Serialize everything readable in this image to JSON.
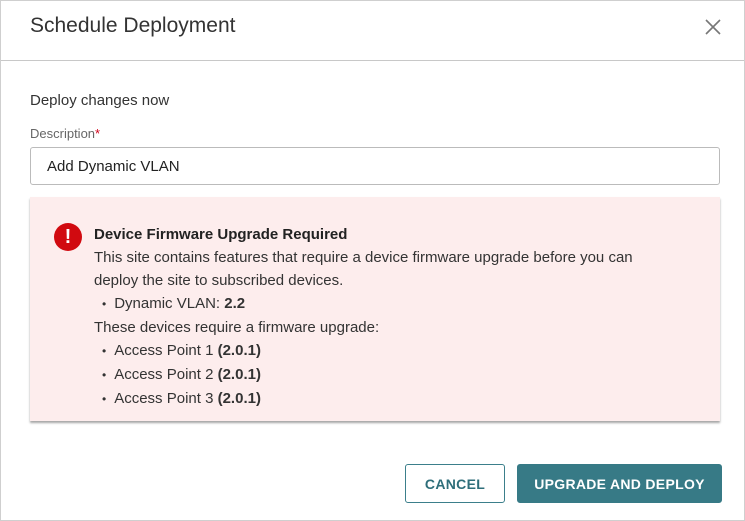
{
  "dialog": {
    "title": "Schedule Deployment"
  },
  "form": {
    "subtitle": "Deploy changes now",
    "description_label": "Description",
    "required_mark": "*",
    "description_value": "Add Dynamic VLAN"
  },
  "alert": {
    "icon": "exclamation-icon",
    "icon_glyph": "!",
    "title": "Device Firmware Upgrade Required",
    "message": "This site contains features that require a device firmware upgrade before you can deploy the site to subscribed devices.",
    "features": [
      {
        "name": "Dynamic VLAN: ",
        "version": "2.2"
      }
    ],
    "devices_intro": "These devices require a firmware upgrade:",
    "devices": [
      {
        "name": "Access Point 1 ",
        "version": "(2.0.1)"
      },
      {
        "name": "Access Point 2 ",
        "version": "(2.0.1)"
      },
      {
        "name": "Access Point 3 ",
        "version": "(2.0.1)"
      }
    ]
  },
  "buttons": {
    "cancel": "CANCEL",
    "deploy": "UPGRADE AND DEPLOY"
  },
  "colors": {
    "accent": "#377a86",
    "alert_bg": "#fdeded",
    "error": "#d10a10"
  }
}
